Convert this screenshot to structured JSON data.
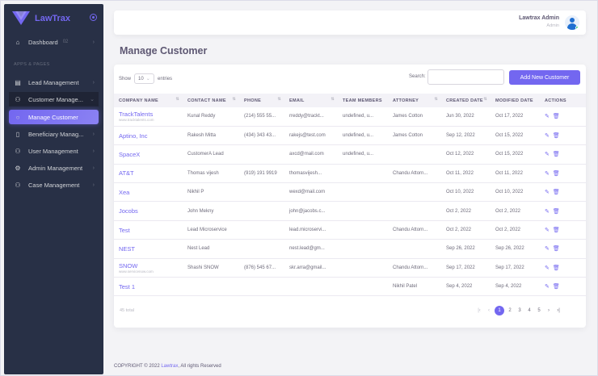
{
  "brand": {
    "name": "LawTrax",
    "accent": "#7367f0",
    "sidebar_bg": "#283046"
  },
  "sidebar": {
    "dashboard": {
      "label": "Dashboard",
      "badge": "02"
    },
    "section": "APPS & PAGES",
    "items": [
      {
        "label": "Lead Management",
        "icon": "document-icon"
      },
      {
        "label": "Customer Manage...",
        "icon": "users-icon"
      },
      {
        "label": "Manage Customer",
        "icon": "circle-icon"
      },
      {
        "label": "Beneficiary Manag...",
        "icon": "clipboard-icon"
      },
      {
        "label": "User Management",
        "icon": "user-icon"
      },
      {
        "label": "Admin Management",
        "icon": "gear-icon"
      },
      {
        "label": "Case Management",
        "icon": "users-icon"
      }
    ]
  },
  "header": {
    "user_name": "Lawtrax Admin",
    "user_role": "Admin"
  },
  "page": {
    "title": "Manage Customer"
  },
  "table_controls": {
    "show_label": "Show",
    "entries_value": "10",
    "entries_label": "entries",
    "search_label": "Search:",
    "add_button": "Add New Customer"
  },
  "columns": [
    "COMPANY NAME",
    "CONTACT NAME",
    "PHONE",
    "EMAIL",
    "TEAM MEMBERS",
    "ATTORNEY",
    "CREATED DATE",
    "MODIFIED DATE",
    "ACTIONS"
  ],
  "rows": [
    {
      "company": "TrackTalents",
      "sub": "www.tracktalents.com",
      "contact": "Kunal Reddy",
      "phone": "(214) 555 55...",
      "email": "rreddy@trackt...",
      "team": "undefined, u...",
      "attorney": "James Cotton",
      "created": "Jun 30, 2022",
      "modified": "Oct 17, 2022"
    },
    {
      "company": "Aptino, Inc",
      "sub": "",
      "contact": "Rakesh Mitta",
      "phone": "(434) 343 43...",
      "email": "rakejs@test.com",
      "team": "undefined, u...",
      "attorney": "James Cotton",
      "created": "Sep 12, 2022",
      "modified": "Oct 15, 2022"
    },
    {
      "company": "SpaceX",
      "sub": "",
      "contact": "CustomerA Lead",
      "phone": "",
      "email": "axcd@mail.com",
      "team": "undefined, u...",
      "attorney": "",
      "created": "Oct 12, 2022",
      "modified": "Oct 15, 2022"
    },
    {
      "company": "AT&T",
      "sub": "",
      "contact": "Thomas vijesh",
      "phone": "(919) 191 9919",
      "email": "thomasvijesh...",
      "team": "",
      "attorney": "Chandu Attorn...",
      "created": "Oct 11, 2022",
      "modified": "Oct 11, 2022"
    },
    {
      "company": "Xea",
      "sub": "",
      "contact": "Nikhil P",
      "phone": "",
      "email": "wexd@mail.com",
      "team": "",
      "attorney": "",
      "created": "Oct 10, 2022",
      "modified": "Oct 10, 2022"
    },
    {
      "company": "Jocobs",
      "sub": "",
      "contact": "John Mekny",
      "phone": "",
      "email": "john@jacobs.c...",
      "team": "",
      "attorney": "",
      "created": "Oct 2, 2022",
      "modified": "Oct 2, 2022"
    },
    {
      "company": "Test",
      "sub": "",
      "contact": "Lead Microservice",
      "phone": "",
      "email": "lead.microservi...",
      "team": "",
      "attorney": "Chandu Attorn...",
      "created": "Oct 2, 2022",
      "modified": "Oct 2, 2022"
    },
    {
      "company": "NEST",
      "sub": "",
      "contact": "Nest Lead",
      "phone": "",
      "email": "nest.lead@gm...",
      "team": "",
      "attorney": "",
      "created": "Sep 26, 2022",
      "modified": "Sep 26, 2022"
    },
    {
      "company": "SNOW",
      "sub": "www.servicenow.com",
      "contact": "Shashi SNOW",
      "phone": "(876) 545 67...",
      "email": "skr.arra@gmail...",
      "team": "",
      "attorney": "Chandu Attorn...",
      "created": "Sep 17, 2022",
      "modified": "Sep 17, 2022"
    },
    {
      "company": "Test 1",
      "sub": "",
      "contact": "",
      "phone": "",
      "email": "",
      "team": "",
      "attorney": "Nikhil Patel",
      "created": "Sep 4, 2022",
      "modified": "Sep 4, 2022"
    }
  ],
  "pagination": {
    "total": "45 total",
    "pages": [
      "1",
      "2",
      "3",
      "4",
      "5"
    ],
    "current": "1",
    "first": "|‹",
    "prev": "‹",
    "next": "›",
    "last": "›|"
  },
  "footer": {
    "prefix": "COPYRIGHT © 2022",
    "link": "Lawtrax",
    "suffix": ", All rights Reserved"
  }
}
